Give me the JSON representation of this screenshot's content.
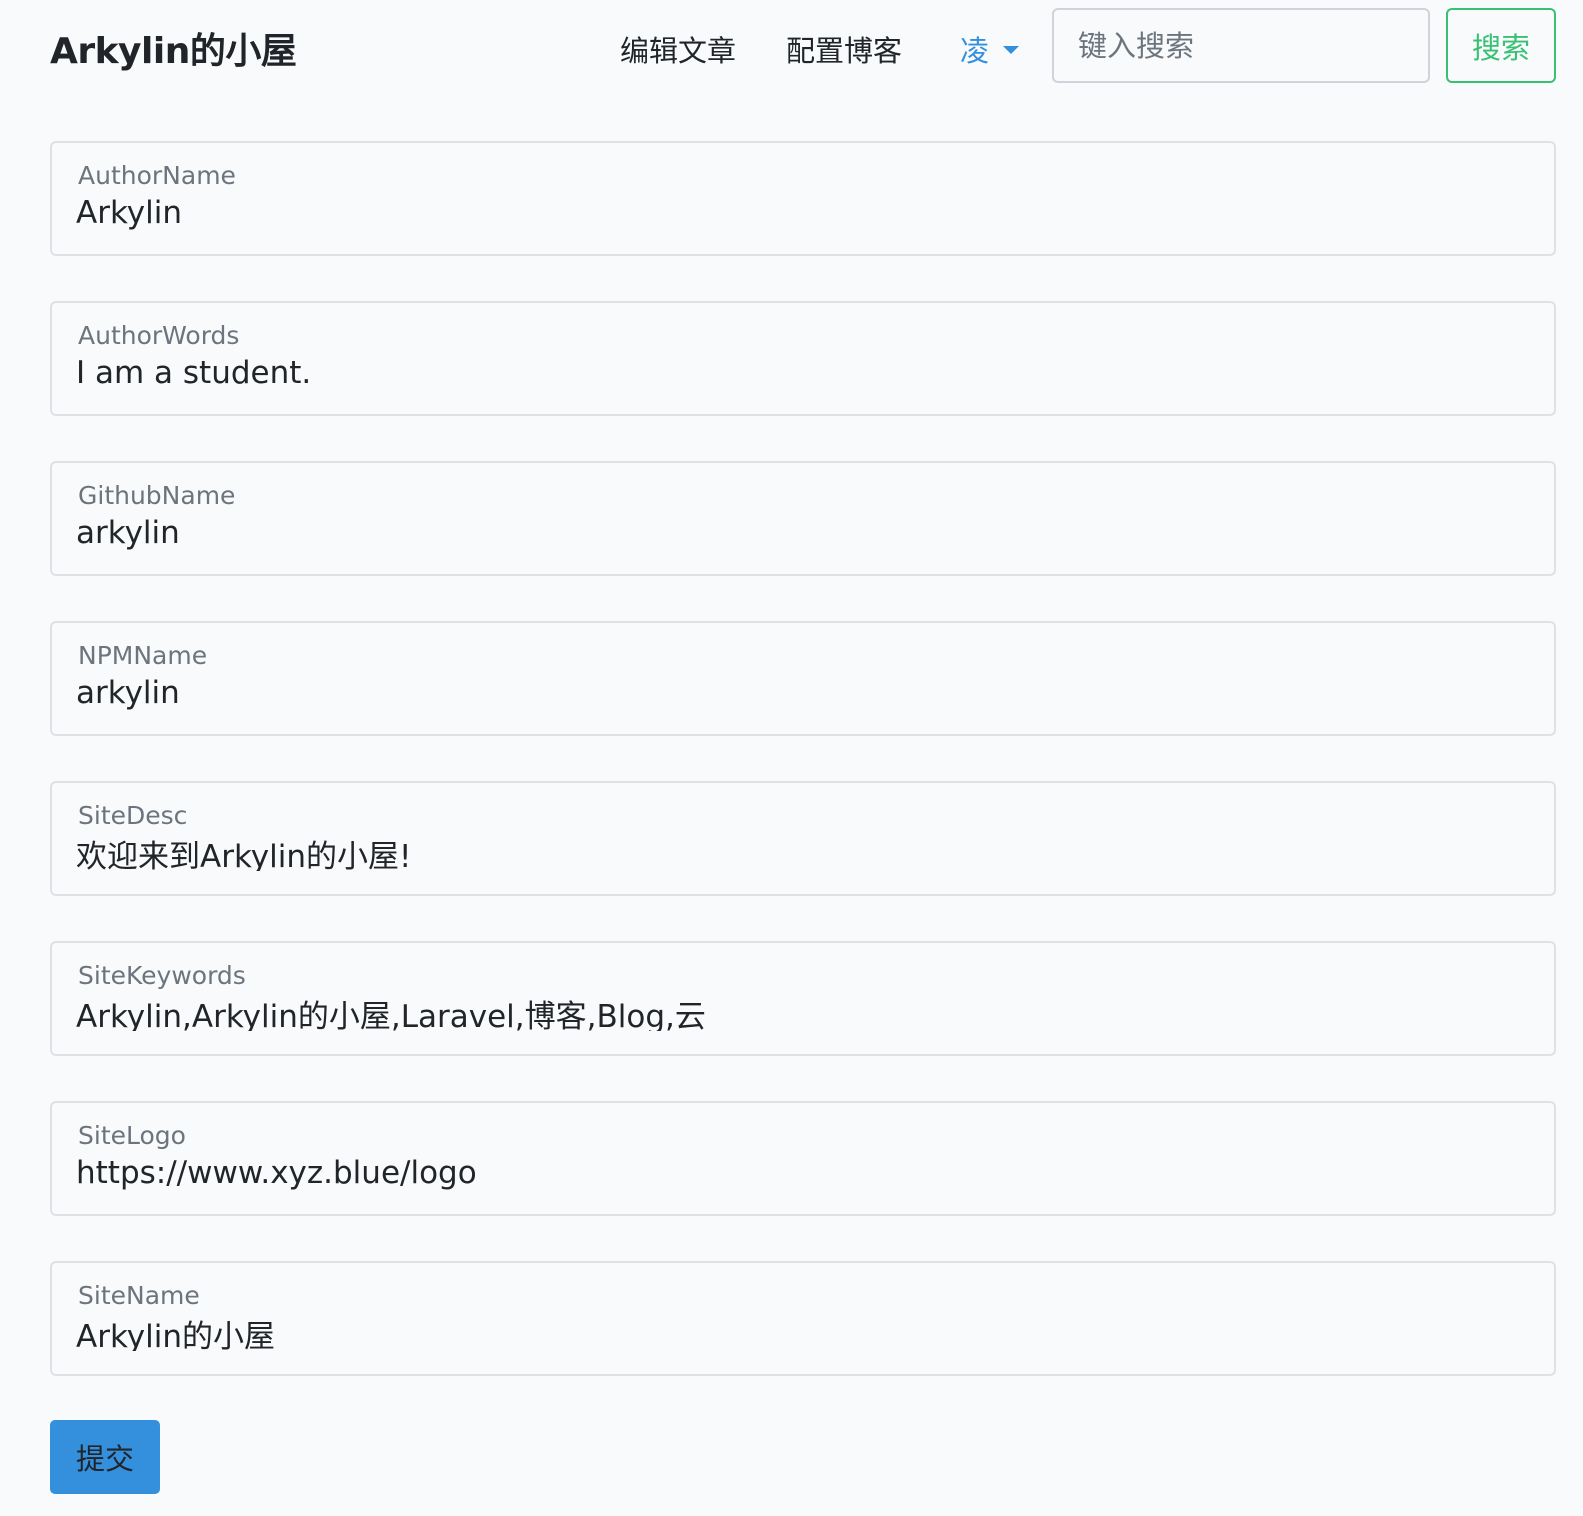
{
  "header": {
    "brand": "Arkylin的小屋",
    "nav_edit": "编辑文章",
    "nav_config": "配置博客",
    "user_name": "凌",
    "search_placeholder": "键入搜索",
    "search_button": "搜索"
  },
  "form": {
    "fields": [
      {
        "label": "AuthorName",
        "value": "Arkylin"
      },
      {
        "label": "AuthorWords",
        "value": "I am a student."
      },
      {
        "label": "GithubName",
        "value": "arkylin"
      },
      {
        "label": "NPMName",
        "value": "arkylin"
      },
      {
        "label": "SiteDesc",
        "value": "欢迎来到Arkylin的小屋!"
      },
      {
        "label": "SiteKeywords",
        "value": "Arkylin,Arkylin的小屋,Laravel,博客,Blog,云"
      },
      {
        "label": "SiteLogo",
        "value": "https://www.xyz.blue/logo"
      },
      {
        "label": "SiteName",
        "value": "Arkylin的小屋"
      }
    ],
    "submit_label": "提交"
  },
  "colors": {
    "background": "#f8fafc",
    "primary": "#3490dc",
    "success": "#38c172",
    "border": "#dee2e6",
    "label": "#6c757d"
  },
  "icons": {
    "dropdown": "caret-down-icon"
  }
}
